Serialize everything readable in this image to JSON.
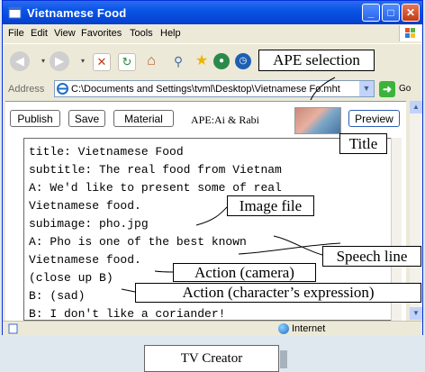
{
  "window": {
    "title": "Vietnamese Food",
    "controls": {
      "minimize": "_",
      "maximize": "□",
      "close": "✕"
    }
  },
  "menu": {
    "items": [
      "File",
      "Edit",
      "View",
      "Favorites",
      "Tools",
      "Help"
    ]
  },
  "toolbar": {
    "icons": [
      "back-icon",
      "forward-icon",
      "stop-icon",
      "refresh-icon",
      "home-icon",
      "search-icon",
      "favorites-icon",
      "media-icon",
      "history-icon"
    ]
  },
  "address": {
    "label": "Address",
    "value": "C:\\Documents and Settings\\tvml\\Desktop\\Vietnamese Fo",
    "value_suffix": ".mht",
    "go_label": "Go"
  },
  "page": {
    "buttons": {
      "publish": "Publish",
      "save": "Save",
      "material": "Material",
      "preview": "Preview"
    },
    "ape_label": "APE:Ai & Rabi",
    "script_lines": [
      "title: Vietnamese Food",
      "subtitle: The real food from Vietnam",
      "A: We'd like to present some of real",
      "Vietnamese food.",
      "subimage: pho.jpg",
      "A: Pho is one of the best known",
      "Vietnamese food.",
      "(close up B)",
      "B: (sad)",
      "B: I don't like a coriander!"
    ]
  },
  "status": {
    "zone": "Internet"
  },
  "annotations": {
    "ape_selection": "APE selection",
    "title": "Title",
    "image_file": "Image file",
    "speech_line": "Speech line",
    "action_camera": "Action (camera)",
    "action_expression": "Action (character’s expression)"
  },
  "caption": "TV Creator",
  "colors": {
    "titlebar": "#0a54e4",
    "chrome": "#ece9d8",
    "backdrop": "#dde9f1"
  }
}
